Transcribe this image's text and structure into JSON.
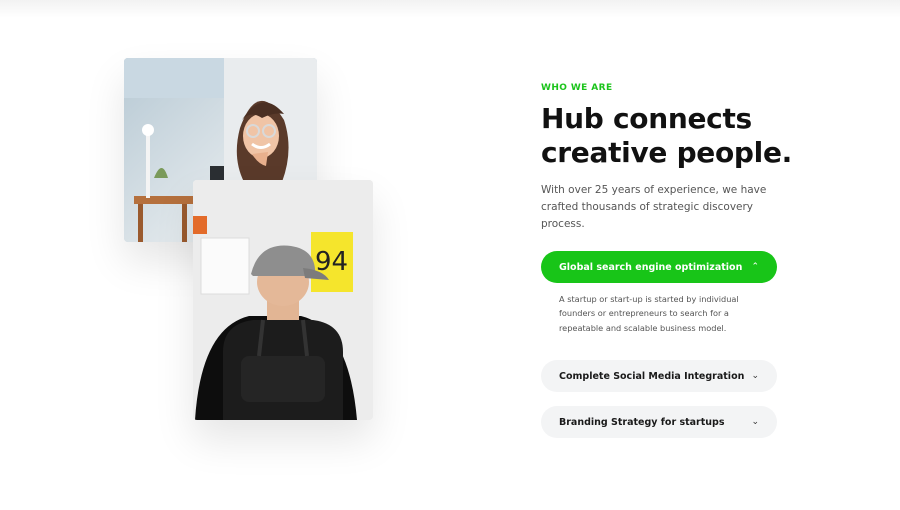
{
  "section": {
    "eyebrow": "WHO WE ARE",
    "headline": "Hub connects creative people.",
    "lead": "With over 25 years of experience, we have crafted thousands of strategic discovery process."
  },
  "accordion": {
    "items": [
      {
        "label": "Global search engine optimization",
        "expanded": true,
        "chevron": "chevron-up",
        "content": "A startup or start-up is started by individual founders or entrepreneurs to search for a repeatable and scalable business model."
      },
      {
        "label": "Complete Social Media Integration",
        "expanded": false,
        "chevron": "chevron-down"
      },
      {
        "label": "Branding Strategy for startups",
        "expanded": false,
        "chevron": "chevron-down"
      }
    ]
  },
  "colors": {
    "accent": "#18c518",
    "text": "#111111",
    "muted": "#555555",
    "pill_bg": "#f3f4f5"
  }
}
